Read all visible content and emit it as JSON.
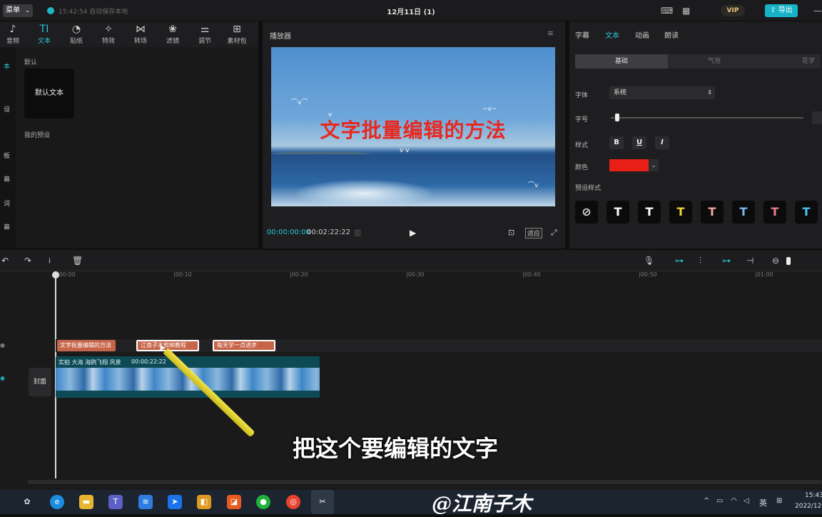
{
  "titlebar": {
    "menu_label": "菜单",
    "save_status": "15:42:54 自动保存本地",
    "doc_title": "12月11日 (1)",
    "vip_label": "VIP",
    "export_label": "导出"
  },
  "toolbar": {
    "items": [
      {
        "label": "音频",
        "icon": "music-icon"
      },
      {
        "label": "文本",
        "icon": "text-icon",
        "glyph": "TI"
      },
      {
        "label": "贴纸",
        "icon": "sticker-icon"
      },
      {
        "label": "特效",
        "icon": "effects-icon"
      },
      {
        "label": "转场",
        "icon": "transition-icon"
      },
      {
        "label": "滤镜",
        "icon": "filter-icon"
      },
      {
        "label": "调节",
        "icon": "adjust-icon"
      },
      {
        "label": "素材包",
        "icon": "package-icon"
      }
    ]
  },
  "left_panel": {
    "side_items": [
      "本",
      "设",
      "板",
      "幕",
      "词",
      "幕"
    ],
    "default_label": "默认",
    "default_card": "默认文本",
    "my_presets": "我的预设"
  },
  "player": {
    "title": "播放器",
    "video_title": "文字批量编辑的方法",
    "time_current": "00:00:00:00",
    "time_total": "00:02:22:22",
    "fit_label": "适应"
  },
  "props": {
    "tabs": [
      "字幕",
      "文本",
      "动画",
      "朗读"
    ],
    "active_tab": "文本",
    "segments": [
      "基础",
      "气泡",
      "花字"
    ],
    "font_label": "字体",
    "font_value": "系统",
    "size_label": "字号",
    "style_label": "样式",
    "style_buttons": [
      "B",
      "U",
      "I"
    ],
    "color_label": "颜色",
    "color_value": "#e81f16",
    "preset_label": "预设样式",
    "presets": [
      {
        "glyph": "⃠",
        "color": "#ddd"
      },
      {
        "glyph": "T",
        "color": "#ffffff"
      },
      {
        "glyph": "T",
        "color": "#ffffff"
      },
      {
        "glyph": "T",
        "color": "#f0d43a"
      },
      {
        "glyph": "T",
        "color": "#f4a6a0"
      },
      {
        "glyph": "T",
        "color": "#7fb8f0"
      },
      {
        "glyph": "T",
        "color": "#f07d8a"
      },
      {
        "glyph": "T",
        "color": "#4fc3f0"
      }
    ]
  },
  "timeline": {
    "ticks": [
      "00:00",
      "00:10",
      "00:20",
      "00:30",
      "00:40",
      "00:50",
      "01:00"
    ],
    "text_clips": [
      "文字批量编辑的方法",
      "江南子木剪映教程",
      "每天学一点进步"
    ],
    "cover_label": "封面",
    "video_clip_label": "实拍 大海 海鸥飞翔 风景",
    "video_clip_duration": "00:00:22:22"
  },
  "overlay": {
    "subtitle": "把这个要编辑的文字",
    "watermark": "@江南子木"
  },
  "taskbar": {
    "lang": "英",
    "clock_time": "15:43",
    "clock_date": "2022/12"
  }
}
